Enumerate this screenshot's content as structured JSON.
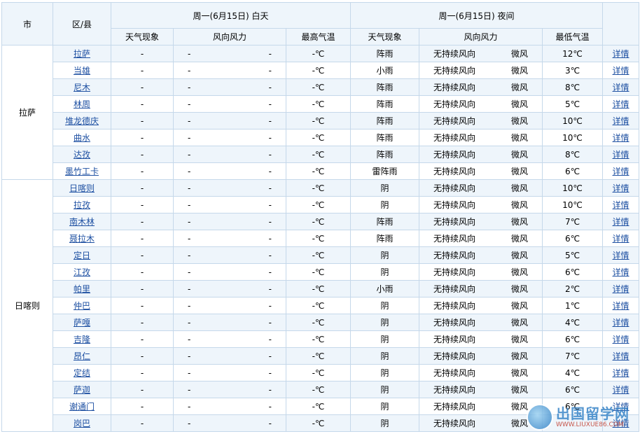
{
  "headers": {
    "city": "市",
    "county": "区/县",
    "day_group": "周一(6月15日) 白天",
    "night_group": "周一(6月15日) 夜间",
    "day_weather": "天气现象",
    "day_wind": "风向风力",
    "day_high": "最高气温",
    "night_weather": "天气现象",
    "night_wind": "风向风力",
    "night_low": "最低气温"
  },
  "cities": [
    {
      "name": "拉萨",
      "rows": [
        {
          "county": "拉萨",
          "day_weather": "-",
          "day_wind_dir": "-",
          "day_wind_pow": "-",
          "day_high": "-℃",
          "night_weather": "阵雨",
          "night_wind_dir": "无持续风向",
          "night_wind_pow": "微风",
          "night_low": "12℃",
          "link": "详情"
        },
        {
          "county": "当雄",
          "day_weather": "-",
          "day_wind_dir": "-",
          "day_wind_pow": "-",
          "day_high": "-℃",
          "night_weather": "小雨",
          "night_wind_dir": "无持续风向",
          "night_wind_pow": "微风",
          "night_low": "3℃",
          "link": "详情"
        },
        {
          "county": "尼木",
          "day_weather": "-",
          "day_wind_dir": "-",
          "day_wind_pow": "-",
          "day_high": "-℃",
          "night_weather": "阵雨",
          "night_wind_dir": "无持续风向",
          "night_wind_pow": "微风",
          "night_low": "8℃",
          "link": "详情"
        },
        {
          "county": "林周",
          "day_weather": "-",
          "day_wind_dir": "-",
          "day_wind_pow": "-",
          "day_high": "-℃",
          "night_weather": "阵雨",
          "night_wind_dir": "无持续风向",
          "night_wind_pow": "微风",
          "night_low": "5℃",
          "link": "详情"
        },
        {
          "county": "堆龙德庆",
          "day_weather": "-",
          "day_wind_dir": "-",
          "day_wind_pow": "-",
          "day_high": "-℃",
          "night_weather": "阵雨",
          "night_wind_dir": "无持续风向",
          "night_wind_pow": "微风",
          "night_low": "10℃",
          "link": "详情"
        },
        {
          "county": "曲水",
          "day_weather": "-",
          "day_wind_dir": "-",
          "day_wind_pow": "-",
          "day_high": "-℃",
          "night_weather": "阵雨",
          "night_wind_dir": "无持续风向",
          "night_wind_pow": "微风",
          "night_low": "10℃",
          "link": "详情"
        },
        {
          "county": "达孜",
          "day_weather": "-",
          "day_wind_dir": "-",
          "day_wind_pow": "-",
          "day_high": "-℃",
          "night_weather": "阵雨",
          "night_wind_dir": "无持续风向",
          "night_wind_pow": "微风",
          "night_low": "8℃",
          "link": "详情"
        },
        {
          "county": "墨竹工卡",
          "day_weather": "-",
          "day_wind_dir": "-",
          "day_wind_pow": "-",
          "day_high": "-℃",
          "night_weather": "雷阵雨",
          "night_wind_dir": "无持续风向",
          "night_wind_pow": "微风",
          "night_low": "6℃",
          "link": "详情"
        }
      ]
    },
    {
      "name": "日喀则",
      "rows": [
        {
          "county": "日喀则",
          "day_weather": "-",
          "day_wind_dir": "-",
          "day_wind_pow": "-",
          "day_high": "-℃",
          "night_weather": "阴",
          "night_wind_dir": "无持续风向",
          "night_wind_pow": "微风",
          "night_low": "10℃",
          "link": "详情"
        },
        {
          "county": "拉孜",
          "day_weather": "-",
          "day_wind_dir": "-",
          "day_wind_pow": "-",
          "day_high": "-℃",
          "night_weather": "阴",
          "night_wind_dir": "无持续风向",
          "night_wind_pow": "微风",
          "night_low": "10℃",
          "link": "详情"
        },
        {
          "county": "南木林",
          "day_weather": "-",
          "day_wind_dir": "-",
          "day_wind_pow": "-",
          "day_high": "-℃",
          "night_weather": "阵雨",
          "night_wind_dir": "无持续风向",
          "night_wind_pow": "微风",
          "night_low": "7℃",
          "link": "详情"
        },
        {
          "county": "聂拉木",
          "day_weather": "-",
          "day_wind_dir": "-",
          "day_wind_pow": "-",
          "day_high": "-℃",
          "night_weather": "阵雨",
          "night_wind_dir": "无持续风向",
          "night_wind_pow": "微风",
          "night_low": "6℃",
          "link": "详情"
        },
        {
          "county": "定日",
          "day_weather": "-",
          "day_wind_dir": "-",
          "day_wind_pow": "-",
          "day_high": "-℃",
          "night_weather": "阴",
          "night_wind_dir": "无持续风向",
          "night_wind_pow": "微风",
          "night_low": "5℃",
          "link": "详情"
        },
        {
          "county": "江孜",
          "day_weather": "-",
          "day_wind_dir": "-",
          "day_wind_pow": "-",
          "day_high": "-℃",
          "night_weather": "阴",
          "night_wind_dir": "无持续风向",
          "night_wind_pow": "微风",
          "night_low": "6℃",
          "link": "详情"
        },
        {
          "county": "帕里",
          "day_weather": "-",
          "day_wind_dir": "-",
          "day_wind_pow": "-",
          "day_high": "-℃",
          "night_weather": "小雨",
          "night_wind_dir": "无持续风向",
          "night_wind_pow": "微风",
          "night_low": "2℃",
          "link": "详情"
        },
        {
          "county": "仲巴",
          "day_weather": "-",
          "day_wind_dir": "-",
          "day_wind_pow": "-",
          "day_high": "-℃",
          "night_weather": "阴",
          "night_wind_dir": "无持续风向",
          "night_wind_pow": "微风",
          "night_low": "1℃",
          "link": "详情"
        },
        {
          "county": "萨嘎",
          "day_weather": "-",
          "day_wind_dir": "-",
          "day_wind_pow": "-",
          "day_high": "-℃",
          "night_weather": "阴",
          "night_wind_dir": "无持续风向",
          "night_wind_pow": "微风",
          "night_low": "4℃",
          "link": "详情"
        },
        {
          "county": "吉隆",
          "day_weather": "-",
          "day_wind_dir": "-",
          "day_wind_pow": "-",
          "day_high": "-℃",
          "night_weather": "阴",
          "night_wind_dir": "无持续风向",
          "night_wind_pow": "微风",
          "night_low": "6℃",
          "link": "详情"
        },
        {
          "county": "昂仁",
          "day_weather": "-",
          "day_wind_dir": "-",
          "day_wind_pow": "-",
          "day_high": "-℃",
          "night_weather": "阴",
          "night_wind_dir": "无持续风向",
          "night_wind_pow": "微风",
          "night_low": "7℃",
          "link": "详情"
        },
        {
          "county": "定结",
          "day_weather": "-",
          "day_wind_dir": "-",
          "day_wind_pow": "-",
          "day_high": "-℃",
          "night_weather": "阴",
          "night_wind_dir": "无持续风向",
          "night_wind_pow": "微风",
          "night_low": "4℃",
          "link": "详情"
        },
        {
          "county": "萨迦",
          "day_weather": "-",
          "day_wind_dir": "-",
          "day_wind_pow": "-",
          "day_high": "-℃",
          "night_weather": "阴",
          "night_wind_dir": "无持续风向",
          "night_wind_pow": "微风",
          "night_low": "6℃",
          "link": "详情"
        },
        {
          "county": "谢通门",
          "day_weather": "-",
          "day_wind_dir": "-",
          "day_wind_pow": "-",
          "day_high": "-℃",
          "night_weather": "阴",
          "night_wind_dir": "无持续风向",
          "night_wind_pow": "微风",
          "night_low": "6℃",
          "link": "详情"
        },
        {
          "county": "岗巴",
          "day_weather": "-",
          "day_wind_dir": "-",
          "day_wind_pow": "-",
          "day_high": "-℃",
          "night_weather": "阴",
          "night_wind_dir": "无持续风向",
          "night_wind_pow": "微风",
          "night_low": "",
          "link": "详情"
        }
      ]
    }
  ],
  "watermark": {
    "title": "出国留学网",
    "url": "WWW.LIUXUE86.COM",
    "logo_icon": "globe-logo-icon"
  },
  "colors": {
    "link": "#1e50a2",
    "border": "#c5d8ea",
    "header_bg": "#eef5fb"
  }
}
